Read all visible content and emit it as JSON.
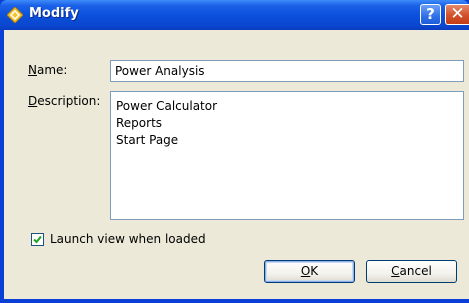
{
  "window": {
    "title": "Modify",
    "icon": "diamond-app-icon",
    "help_glyph": "?",
    "close_glyph": "✕",
    "colors": {
      "titlebar": "#0b50dc",
      "client": "#ece9d8",
      "close": "#d2502a"
    }
  },
  "form": {
    "name_label_access": "N",
    "name_label_rest": "ame:",
    "name_value": "Power Analysis",
    "description_label_access": "D",
    "description_label_rest": "escription:",
    "description_lines": [
      "Power Calculator",
      "Reports",
      "Start Page"
    ],
    "launch_checkbox_label": "Launch view when loaded",
    "launch_checked": true
  },
  "buttons": {
    "ok_access": "O",
    "ok_rest": "K",
    "cancel_access": "C",
    "cancel_rest": "ancel"
  }
}
